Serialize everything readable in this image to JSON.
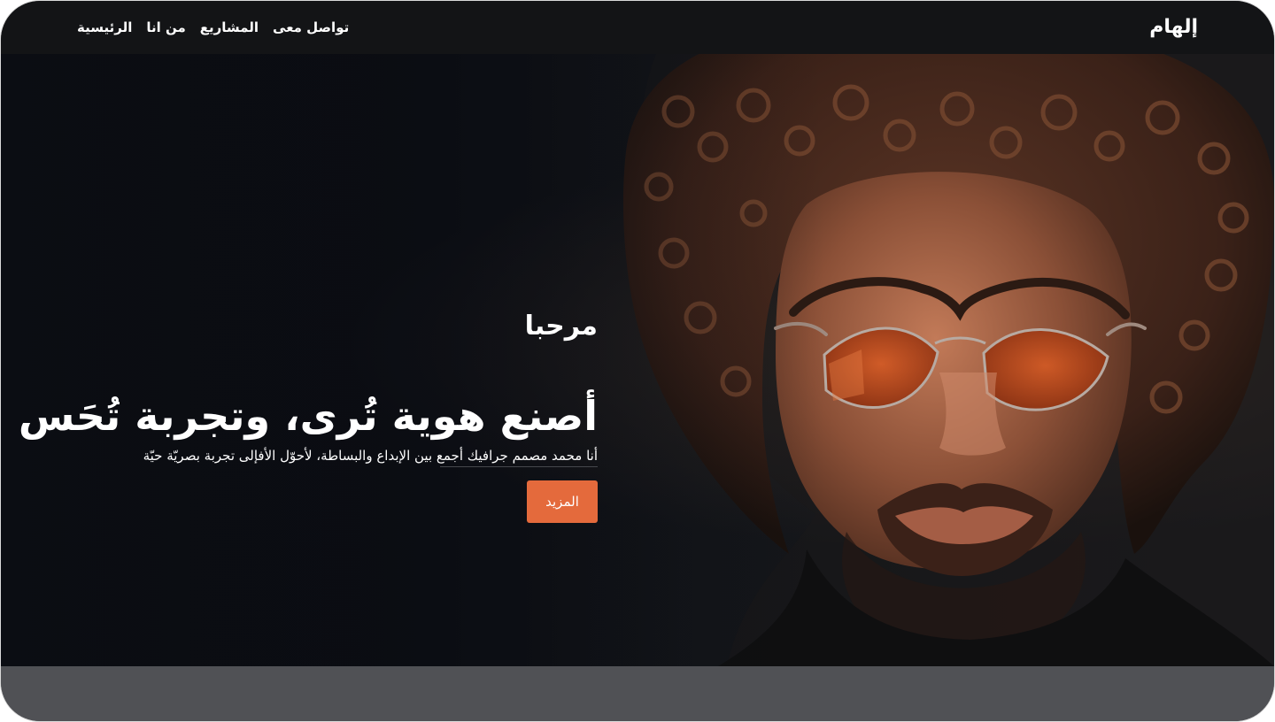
{
  "header": {
    "brand": "إلهام",
    "nav": [
      {
        "label": "الرئيسية"
      },
      {
        "label": "من انا"
      },
      {
        "label": "المشاريع"
      },
      {
        "label": "تواصل معى"
      }
    ]
  },
  "hero": {
    "greeting": "مرحبا",
    "headline": "أصنع هوية تُرى، وتجربة تُحَس",
    "intro": "أنا محمد مصمم جرافيك أجمع بين الإبداع والبساطة، لأحوّل الأفإلى تجربة بصريّة حيّة",
    "button_label": "المزيد",
    "portrait_icon": "portrait-photo-icon"
  },
  "colors": {
    "header_bg": "#131416",
    "hero_bg": "#0b0d13",
    "accent": "#e46a3c",
    "lens": "#d45a24",
    "footer_bg": "#505155",
    "text": "#ffffff"
  }
}
